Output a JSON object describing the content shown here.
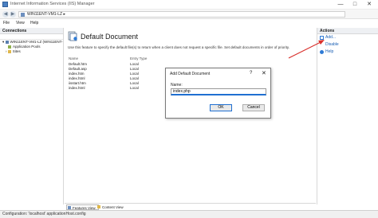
{
  "window": {
    "title": "Internet Information Services (IIS) Manager",
    "minimize": "—",
    "maximize": "□",
    "close": "✕"
  },
  "address": {
    "crumb": "WIN11ENT-VM1-LZ  ▸"
  },
  "menu": {
    "file": "File",
    "view": "View",
    "help": "Help"
  },
  "connections": {
    "title": "Connections",
    "server": "WIN11ENT-VM1-LZ (WIN11ENT-",
    "app_pools": "Application Pools",
    "sites": "Sites"
  },
  "main": {
    "heading": "Default Document",
    "description": "Use this feature to specify the default file(s) to return when a client does not request a specific file. Set default documents in order of priority.",
    "columns": [
      "Name",
      "Entry Type"
    ],
    "rows": [
      {
        "name": "Default.htm",
        "type": "Local"
      },
      {
        "name": "Default.asp",
        "type": "Local"
      },
      {
        "name": "index.htm",
        "type": "Local"
      },
      {
        "name": "index.html",
        "type": "Local"
      },
      {
        "name": "iisstart.htm",
        "type": "Local"
      },
      {
        "name": "index.html",
        "type": "Local"
      }
    ]
  },
  "view_tabs": {
    "features": "Features View",
    "content": "Content View"
  },
  "actions": {
    "title": "Actions",
    "add": "Add...",
    "disable": "Disable",
    "help": "Help"
  },
  "status": {
    "text": "Configuration: 'localhost' applicationHost.config"
  },
  "dialog": {
    "title": "Add Default Document",
    "help": "?",
    "close": "✕",
    "name_label": "Name:",
    "name_value": "index.php",
    "ok": "OK",
    "cancel": "Cancel"
  },
  "colors": {
    "link": "#1a5fb4",
    "annotation_arrow": "#d9302c",
    "focus": "#1f6fd1"
  }
}
